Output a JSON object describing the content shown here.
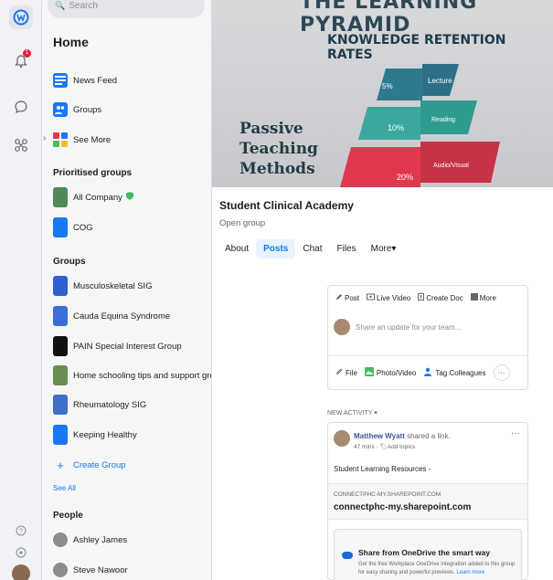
{
  "sidebar": {
    "search_placeholder": "Search",
    "home_title": "Home",
    "nav": [
      {
        "label": "News Feed"
      },
      {
        "label": "Groups"
      },
      {
        "label": "See More"
      }
    ],
    "prioritised_title": "Prioritised groups",
    "prioritised": [
      {
        "label": "All Company"
      },
      {
        "label": "COG"
      }
    ],
    "groups_title": "Groups",
    "groups": [
      {
        "label": "Musculoskeletal SIG"
      },
      {
        "label": "Cauda Equina Syndrome"
      },
      {
        "label": "PAIN Special Interest Group"
      },
      {
        "label": "Home schooling tips and support group"
      },
      {
        "label": "Rheumatology SIG"
      },
      {
        "label": "Keeping Healthy"
      },
      {
        "label": "Create Group"
      }
    ],
    "see_all": "See All",
    "people_title": "People",
    "people": [
      {
        "label": "Ashley James"
      },
      {
        "label": "Steve Nawoor"
      }
    ]
  },
  "cover": {
    "title": "THE LEARNING PYRAMID",
    "subtitle": "KNOWLEDGE RETENTION RATES",
    "side_text": [
      "Passive",
      "Teaching",
      "Methods"
    ],
    "tiers": [
      {
        "pct": "5%",
        "label": "Lecture"
      },
      {
        "pct": "10%",
        "label": "Reading"
      },
      {
        "pct": "20%",
        "label": "Audio/Visual"
      }
    ]
  },
  "group": {
    "title": "Student Clinical Academy",
    "subtitle": "Open group",
    "tabs": [
      {
        "label": "About"
      },
      {
        "label": "Posts"
      },
      {
        "label": "Chat"
      },
      {
        "label": "Files"
      },
      {
        "label": "More▾"
      }
    ]
  },
  "composer": {
    "tabs": [
      {
        "label": "Post"
      },
      {
        "label": "Live Video"
      },
      {
        "label": "Create Doc"
      },
      {
        "label": "More"
      }
    ],
    "placeholder": "Share an update for your team...",
    "actions": [
      {
        "label": "File"
      },
      {
        "label": "Photo/Video"
      },
      {
        "label": "Tag Colleagues"
      }
    ],
    "more": "···"
  },
  "feed": {
    "new_activity": "NEW ACTIVITY ▾"
  },
  "post": {
    "author": "Matthew Wyatt",
    "action": " shared a link.",
    "time": "47 mins · ",
    "add_topics": "Add topics",
    "menu": "···",
    "text": "Student Learning Resources -",
    "link_domain": "CONNECTPHC-MY.SHAREPOINT.COM",
    "link_url": "connectphc-my.sharepoint.com",
    "onedrive_title": "Share from OneDrive the smart way",
    "onedrive_desc": "Get the free Workplace OneDrive integration added to this group for easy sharing and powerful previews.",
    "learn_more": "Learn more"
  },
  "colors": {
    "accent": "#1877f2",
    "pyramid_top": "#2d7a8f",
    "pyramid_mid": "#3aa89c",
    "pyramid_low": "#e0394f"
  }
}
